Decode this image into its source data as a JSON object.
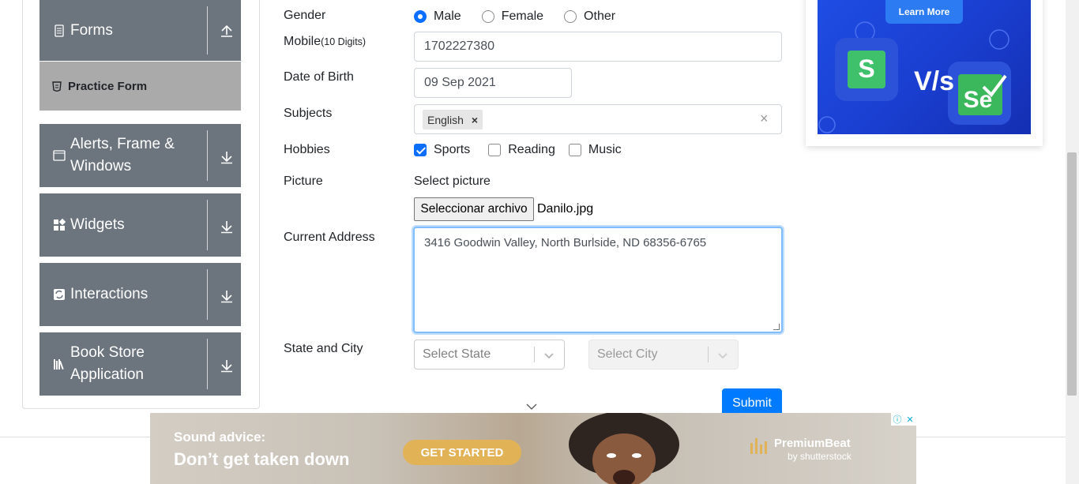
{
  "sidebar": {
    "forms": {
      "label": "Forms"
    },
    "practice_form": {
      "label": "Practice Form"
    },
    "alerts": {
      "label": "Alerts, Frame & Windows"
    },
    "widgets": {
      "label": "Widgets"
    },
    "interactions": {
      "label": "Interactions"
    },
    "book_store": {
      "label": "Book Store Application"
    }
  },
  "form": {
    "gender": {
      "label": "Gender",
      "options": [
        "Male",
        "Female",
        "Other"
      ],
      "selected": "Male"
    },
    "mobile": {
      "label": "Mobile",
      "hint": "(10 Digits)",
      "value": "1702227380"
    },
    "dob": {
      "label": "Date of Birth",
      "value": "09 Sep 2021"
    },
    "subjects": {
      "label": "Subjects",
      "tag": "English",
      "tag_remove": "×",
      "clear": "×"
    },
    "hobbies": {
      "label": "Hobbies",
      "options": [
        "Sports",
        "Reading",
        "Music"
      ],
      "checked": [
        "Sports"
      ]
    },
    "picture": {
      "label": "Picture",
      "select_text": "Select picture",
      "button": "Seleccionar archivo",
      "file": "Danilo.jpg"
    },
    "address": {
      "label": "Current Address",
      "value": "3416 Goodwin Valley, North Burlside, ND 68356-6765"
    },
    "state_city": {
      "label": "State and City",
      "state_placeholder": "Select State",
      "city_placeholder": "Select City"
    },
    "submit": "Submit"
  },
  "side_ad": {
    "button": "Learn More",
    "vs": "V/s"
  },
  "bottom_ad": {
    "line1": "Sound advice:",
    "line2": "Don’t get taken down",
    "cta": "GET STARTED",
    "brand": "PremiumBeat",
    "brand_sub": "by shutterstock"
  },
  "colors": {
    "sidebar": "#6c757d",
    "active": "#aaaaaa",
    "primary": "#007bff"
  }
}
